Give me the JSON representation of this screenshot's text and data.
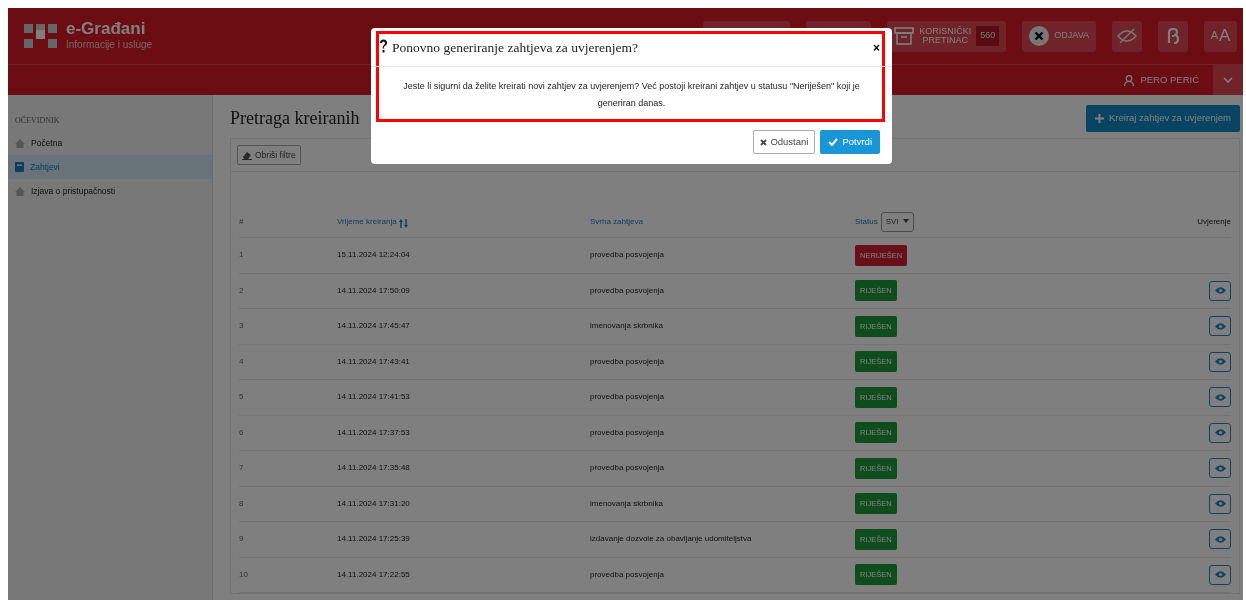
{
  "header": {
    "brand": "e-Građani",
    "tagline": "Informacije i usluge",
    "mailbox": {
      "label_1": "KORISNIČKI",
      "label_2": "PRETINAC",
      "count": "560"
    },
    "logout": "ODJAVA",
    "text_size": {
      "small": "A",
      "large": "A"
    }
  },
  "user_bar": {
    "user": "PERO PERIĆ"
  },
  "sidebar": {
    "section": "OČEVIDNIK",
    "items": [
      {
        "label": "Početna",
        "selected": false
      },
      {
        "label": "Zahtjevi",
        "selected": true
      },
      {
        "label": "Izjava o pristupačnosti",
        "selected": false
      }
    ]
  },
  "page": {
    "title": "Pretraga kreiranih",
    "create_button": "Kreiraj zahtjev za uvjerenjem",
    "clear_filters": "Obriši filtre"
  },
  "table": {
    "columns": {
      "index": "#",
      "time": "Vrijeme kreiranja",
      "purpose": "Svrha zahtjeva",
      "status": "Status",
      "status_filter": "SVI",
      "certificate": "Uvjerenje"
    },
    "rows": [
      {
        "index": "1",
        "time": "15.11.2024 12:24:04",
        "purpose": "provedba posvojenja",
        "status": "NERIJEŠEN",
        "kind": "unresolved",
        "view": false
      },
      {
        "index": "2",
        "time": "14.11.2024 17:50:09",
        "purpose": "provedba posvojenja",
        "status": "RIJEŠEN",
        "kind": "resolved",
        "view": true
      },
      {
        "index": "3",
        "time": "14.11.2024 17:45:47",
        "purpose": "imenovanja skrbnika",
        "status": "RIJEŠEN",
        "kind": "resolved",
        "view": true
      },
      {
        "index": "4",
        "time": "14.11.2024 17:43:41",
        "purpose": "provedba posvojenja",
        "status": "RIJEŠEN",
        "kind": "resolved",
        "view": true
      },
      {
        "index": "5",
        "time": "14.11.2024 17:41:53",
        "purpose": "provedba posvojenja",
        "status": "RIJEŠEN",
        "kind": "resolved",
        "view": true
      },
      {
        "index": "6",
        "time": "14.11.2024 17:37:53",
        "purpose": "provedba posvojenja",
        "status": "RIJEŠEN",
        "kind": "resolved",
        "view": true
      },
      {
        "index": "7",
        "time": "14.11.2024 17:35:48",
        "purpose": "provedba posvojenja",
        "status": "RIJEŠEN",
        "kind": "resolved",
        "view": true
      },
      {
        "index": "8",
        "time": "14.11.2024 17:31:20",
        "purpose": "imenovanja skrbnika",
        "status": "RIJEŠEN",
        "kind": "resolved",
        "view": true
      },
      {
        "index": "9",
        "time": "14.11.2024 17:25:39",
        "purpose": "izdavanje dozvole za obavljanje udomiteljstva",
        "status": "RIJEŠEN",
        "kind": "resolved",
        "view": true
      },
      {
        "index": "10",
        "time": "14.11.2024 17:22:55",
        "purpose": "provedba posvojenja",
        "status": "RIJEŠEN",
        "kind": "resolved",
        "view": true
      }
    ]
  },
  "modal": {
    "title": "Ponovno generiranje zahtjeva za uvjerenjem?",
    "close": "×",
    "message": "Jeste li sigurni da želite kreirati novi zahtjev za uvjerenjem? Već postoji kreirani zahtjev u statusu \"Neriješen\" koji je generiran danas.",
    "cancel": "Odustani",
    "confirm": "Potvrdi",
    "highlighted": true
  }
}
